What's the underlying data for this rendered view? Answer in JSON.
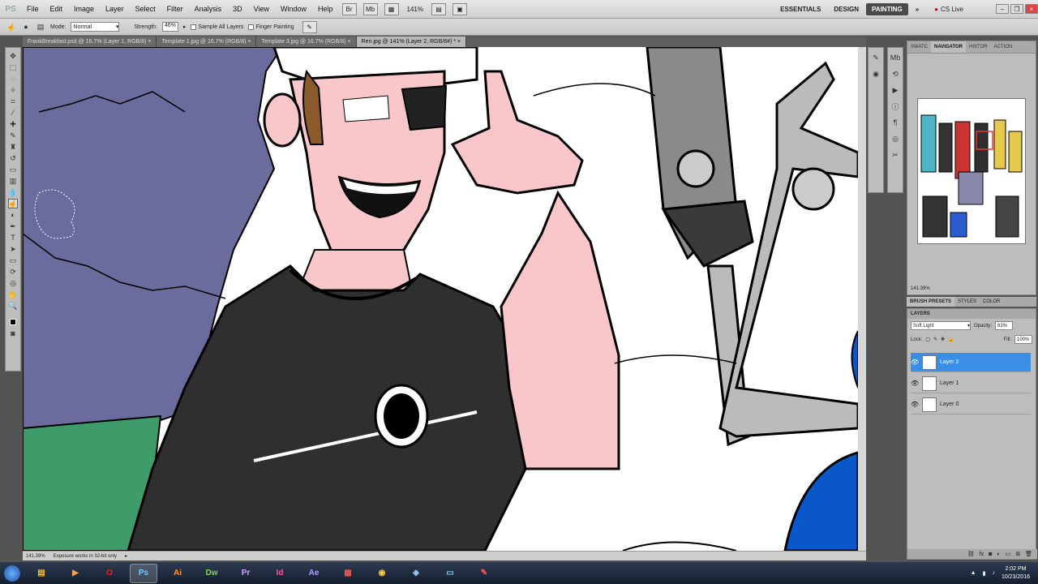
{
  "app": {
    "logo": "PS"
  },
  "menu": [
    "File",
    "Edit",
    "Image",
    "Layer",
    "Select",
    "Filter",
    "Analysis",
    "3D",
    "View",
    "Window",
    "Help"
  ],
  "menubar": {
    "zoom": "141%"
  },
  "workspaces": [
    "ESSENTIALS",
    "DESIGN",
    "PAINTING"
  ],
  "workspace_active": "PAINTING",
  "cslive": "CS Live",
  "options": {
    "mode_label": "Mode:",
    "mode_value": "Normal",
    "strength_label": "Strength:",
    "strength_value": "46%",
    "sample_all": "Sample All Layers",
    "finger_painting": "Finger Painting"
  },
  "doc_tabs": [
    {
      "label": "FrankBreakfast.psd @ 16.7% (Layer 1, RGB/8)",
      "active": false
    },
    {
      "label": "Template 1.jpg @ 16.7% (RGB/8)",
      "active": false
    },
    {
      "label": "Template 3.jpg @ 16.7% (RGB/8)",
      "active": false
    },
    {
      "label": "Ren.jpg @ 141% (Layer 2, RGB/8#) *",
      "active": true
    }
  ],
  "status": {
    "zoom": "141.39%",
    "info": "Exposure works in 32-bit only"
  },
  "panels": {
    "top_tabs": [
      "SWATC",
      "NAVIGATOR",
      "HISTOR",
      "ACTION"
    ],
    "top_active": "NAVIGATOR",
    "nav_zoom": "141.39%",
    "brush_tabs": [
      "BRUSH PRESETS",
      "STYLES",
      "COLOR"
    ]
  },
  "layers_panel": {
    "title": "LAYERS",
    "blend_mode": "Soft Light",
    "opacity_label": "Opacity:",
    "opacity_value": "63%",
    "lock_label": "Lock:",
    "fill_label": "Fill:",
    "fill_value": "100%",
    "layers": [
      {
        "name": "Layer 2",
        "selected": true
      },
      {
        "name": "Layer 1",
        "selected": false
      },
      {
        "name": "Layer 0",
        "selected": false
      }
    ]
  },
  "taskbar": {
    "apps": [
      "Ai",
      "Dw",
      "Pr",
      "Id",
      "Ae",
      "Ps"
    ],
    "time": "2:02 PM",
    "date": "10/23/2016"
  },
  "colors": {
    "accent": "#3a8ee6",
    "purple_bg": "#6b6b9e",
    "skin": "#f9c6c9",
    "shirt": "#2f2f2f",
    "grass": "#3e9b6a",
    "blue_shape": "#0a57c9"
  }
}
